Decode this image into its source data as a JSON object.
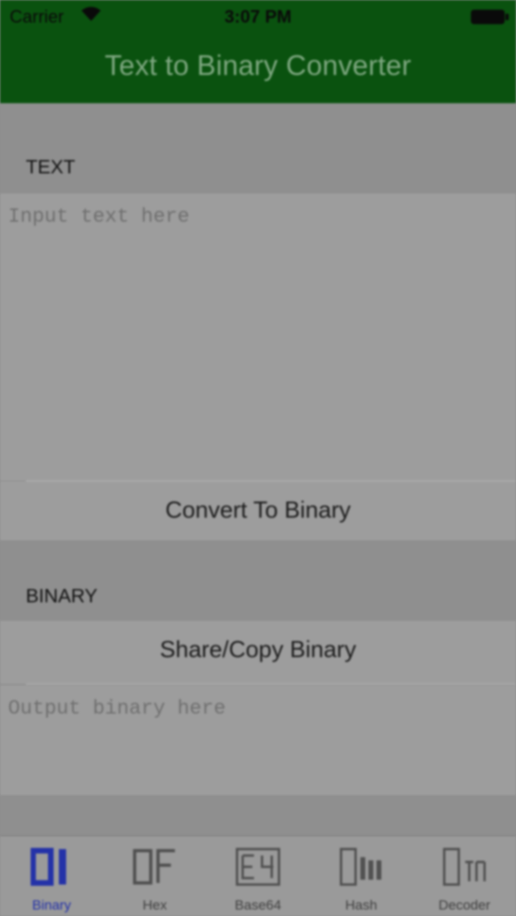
{
  "status_bar": {
    "carrier": "Carrier",
    "time": "3:07 PM"
  },
  "nav": {
    "title": "Text to Binary Converter"
  },
  "text_section": {
    "header": "TEXT",
    "input_placeholder": "Input text here",
    "input_value": "",
    "convert_button": "Convert To Binary"
  },
  "binary_section": {
    "header": "BINARY",
    "share_button": "Share/Copy Binary",
    "output_placeholder": "Output binary here",
    "output_value": ""
  },
  "tabs": [
    {
      "label": "Binary",
      "icon": "binary-01-icon",
      "active": true
    },
    {
      "label": "Hex",
      "icon": "hex-0f-icon",
      "active": false
    },
    {
      "label": "Base64",
      "icon": "base64-icon",
      "active": false
    },
    {
      "label": "Hash",
      "icon": "hash-icon",
      "active": false
    },
    {
      "label": "Decoder",
      "icon": "decoder-icon",
      "active": false
    }
  ],
  "colors": {
    "nav_bar": "#0a520f",
    "active_tab": "#2432a8",
    "overlay_gray": "#8f8f8f"
  }
}
